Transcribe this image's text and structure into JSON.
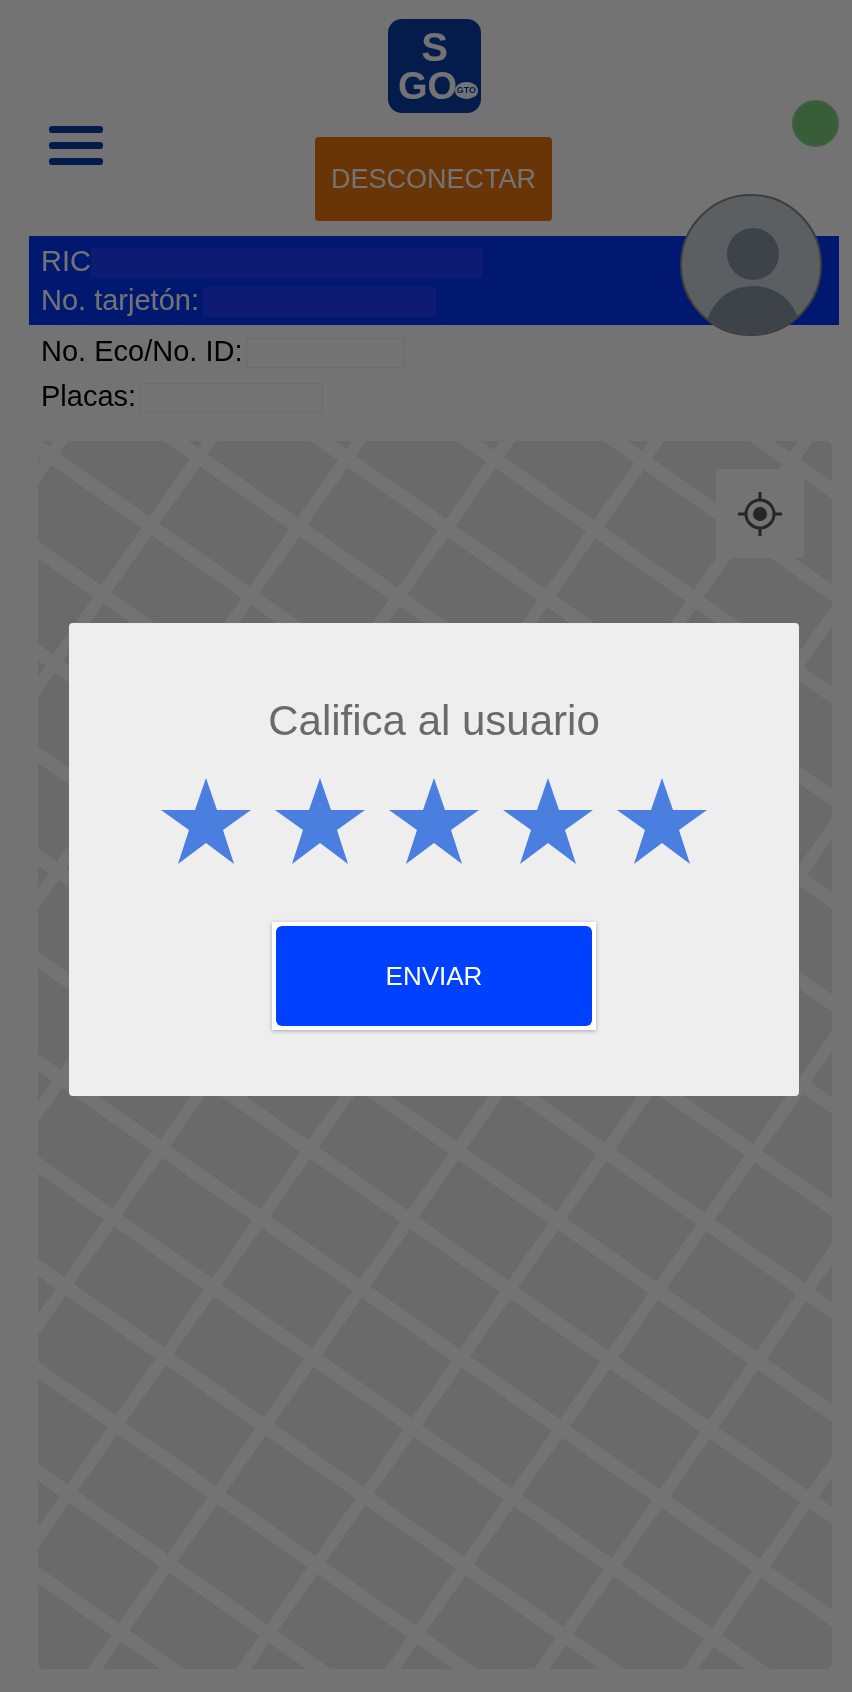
{
  "logo": {
    "top": "S",
    "bottom": "GO",
    "badge": "GTO"
  },
  "connection": {
    "connected": true
  },
  "disconnect_button": {
    "label": "DESCONECTAR"
  },
  "driver": {
    "name": "RIC",
    "card_label": "No. tarjetón:",
    "eco_label": "No. Eco/No. ID:",
    "plates_label": "Placas:"
  },
  "rating_dialog": {
    "title": "Califica al usuario",
    "stars": 5,
    "button": "ENVIAR"
  }
}
